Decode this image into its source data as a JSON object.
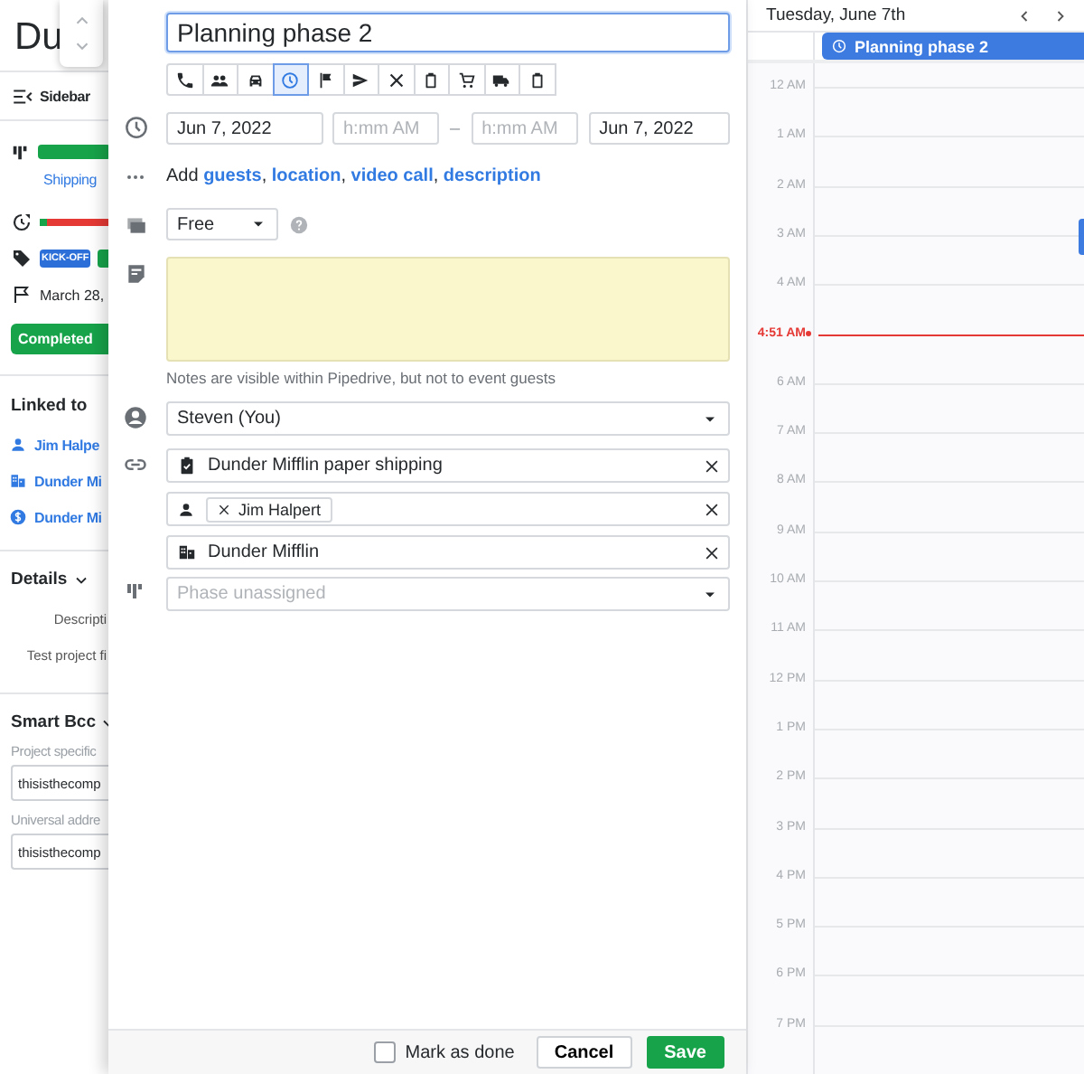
{
  "background_page": {
    "title": "Du",
    "sidebar_label": "Sidebar",
    "stage_link": "Shipping",
    "tags": [
      {
        "label": "KICK-OFF",
        "color": "#2d6fd8"
      },
      {
        "color": "#17a34a"
      }
    ],
    "date": "March 28,",
    "status_button": "Completed",
    "linked_heading": "Linked to",
    "linked": [
      {
        "kind": "person",
        "label": "Jim Halpe"
      },
      {
        "kind": "organization",
        "label": "Dunder Mi"
      },
      {
        "kind": "deal",
        "label": "Dunder Mi"
      }
    ],
    "details_heading": "Details",
    "details_fields": [
      "Descripti",
      "Test project fi"
    ],
    "smart_bcc_heading": "Smart Bcc",
    "bcc_fields": [
      {
        "label": "Project specific",
        "value": "thisisthecomp"
      },
      {
        "label": "Universal addre",
        "value": "thisisthecomp"
      }
    ]
  },
  "activity_form": {
    "subject": "Planning phase 2",
    "types": [
      {
        "kind": "call",
        "selected": false
      },
      {
        "kind": "meeting",
        "selected": false
      },
      {
        "kind": "car",
        "selected": false
      },
      {
        "kind": "clock",
        "selected": true
      },
      {
        "kind": "flag",
        "selected": false
      },
      {
        "kind": "send",
        "selected": false
      },
      {
        "kind": "lunch",
        "selected": false
      },
      {
        "kind": "clipboard",
        "selected": false
      },
      {
        "kind": "cart",
        "selected": false
      },
      {
        "kind": "truck",
        "selected": false
      },
      {
        "kind": "clipboard",
        "selected": false
      }
    ],
    "start_date": "Jun 7, 2022",
    "start_time_placeholder": "h:mm AM",
    "range_separator": "–",
    "end_time_placeholder": "h:mm AM",
    "end_date": "Jun 7, 2022",
    "add_line": [
      {
        "kind": "plain",
        "text": "Add "
      },
      {
        "kind": "link",
        "text": "guests"
      },
      {
        "kind": "plain",
        "text": ", "
      },
      {
        "kind": "link",
        "text": "location"
      },
      {
        "kind": "plain",
        "text": ", "
      },
      {
        "kind": "link",
        "text": "video call"
      },
      {
        "kind": "plain",
        "text": ", "
      },
      {
        "kind": "link",
        "text": "description"
      }
    ],
    "availability": "Free",
    "note_hint": "Notes are visible within Pipedrive, but not to event guests",
    "owner": "Steven (You)",
    "links": [
      {
        "kind": "deal",
        "value": "Dunder Mifflin paper shipping"
      },
      {
        "kind": "person",
        "chip": "Jim Halpert"
      },
      {
        "kind": "organization",
        "value": "Dunder Mifflin"
      }
    ],
    "phase_placeholder": "Phase unassigned",
    "mark_done": {
      "label": "Mark as done",
      "checked": false
    },
    "cancel": "Cancel",
    "save": "Save"
  },
  "calendar": {
    "date": "Tuesday, June 7th",
    "all_day_event": "Planning phase 2",
    "rows": [
      {
        "kind": "hour",
        "label": "12 AM"
      },
      {
        "kind": "hour",
        "label": "1 AM"
      },
      {
        "kind": "hour",
        "label": "2 AM"
      },
      {
        "kind": "hour",
        "label": "3 AM"
      },
      {
        "kind": "hour",
        "label": "4 AM"
      },
      {
        "kind": "now",
        "label": "4:51 AM"
      },
      {
        "kind": "hour",
        "label": "6 AM"
      },
      {
        "kind": "hour",
        "label": "7 AM"
      },
      {
        "kind": "hour",
        "label": "8 AM"
      },
      {
        "kind": "hour",
        "label": "9 AM"
      },
      {
        "kind": "hour",
        "label": "10 AM"
      },
      {
        "kind": "hour",
        "label": "11 AM"
      },
      {
        "kind": "hour",
        "label": "12 PM"
      },
      {
        "kind": "hour",
        "label": "1 PM"
      },
      {
        "kind": "hour",
        "label": "2 PM"
      },
      {
        "kind": "hour",
        "label": "3 PM"
      },
      {
        "kind": "hour",
        "label": "4 PM"
      },
      {
        "kind": "hour",
        "label": "5 PM"
      },
      {
        "kind": "hour",
        "label": "6 PM"
      },
      {
        "kind": "hour",
        "label": "7 PM"
      }
    ]
  }
}
